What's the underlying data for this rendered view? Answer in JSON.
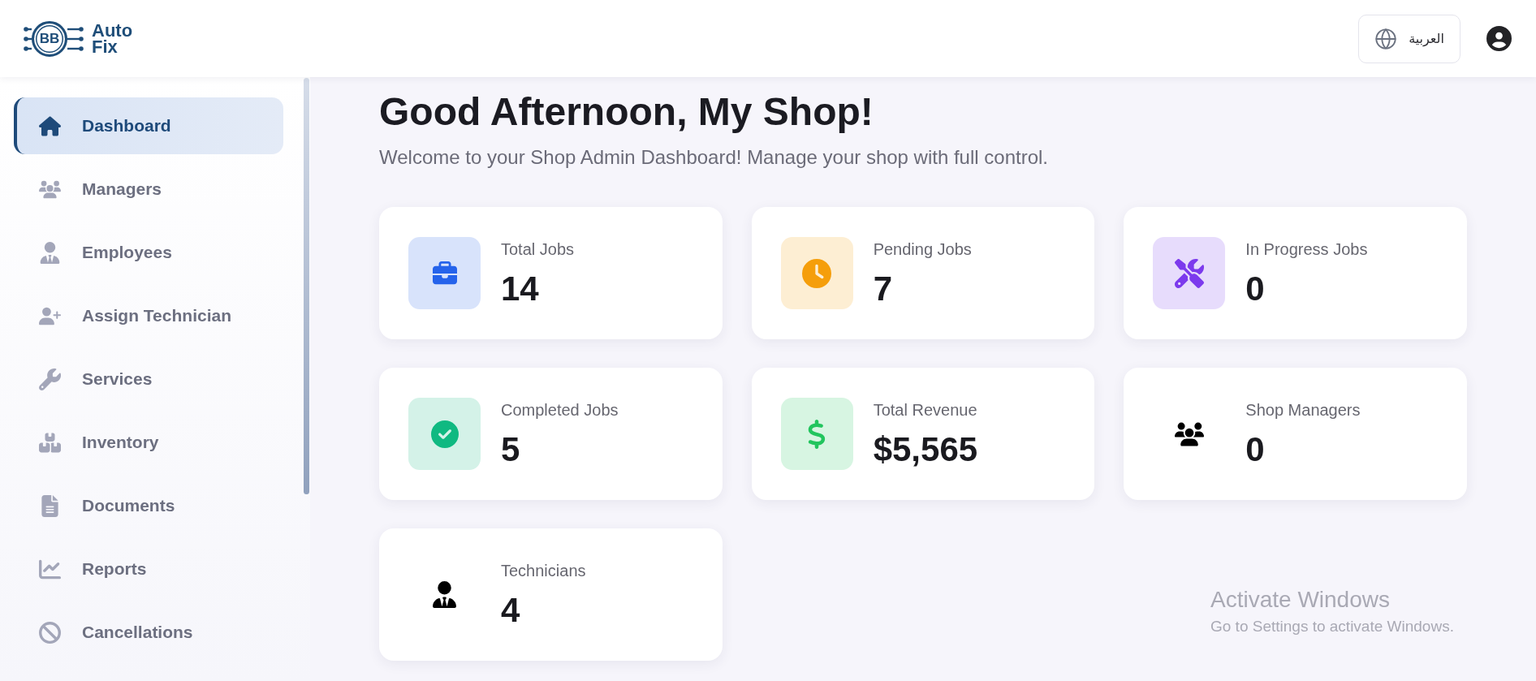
{
  "header": {
    "logo": {
      "initials": "BB",
      "name_lines": [
        "Auto",
        "Fix"
      ]
    },
    "language_button": {
      "label": "العربية"
    }
  },
  "sidebar": {
    "items": [
      {
        "label": "Dashboard",
        "selected": true
      },
      {
        "label": "Managers",
        "selected": false
      },
      {
        "label": "Employees",
        "selected": false
      },
      {
        "label": "Assign Technician",
        "selected": false
      },
      {
        "label": "Services",
        "selected": false
      },
      {
        "label": "Inventory",
        "selected": false
      },
      {
        "label": "Documents",
        "selected": false
      },
      {
        "label": "Reports",
        "selected": false
      },
      {
        "label": "Cancellations",
        "selected": false
      }
    ]
  },
  "main": {
    "greeting": "Good Afternoon, My Shop!",
    "subtitle": "Welcome to your Shop Admin Dashboard! Manage your shop with full control."
  },
  "stats": [
    {
      "label": "Total Jobs",
      "value": "14",
      "kind": "tinted",
      "color": "#2563eb"
    },
    {
      "label": "Pending Jobs",
      "value": "7",
      "kind": "tinted",
      "color": "#f59e0b"
    },
    {
      "label": "In Progress Jobs",
      "value": "0",
      "kind": "tinted",
      "color": "#7c3aed"
    },
    {
      "label": "Completed Jobs",
      "value": "5",
      "kind": "tinted",
      "color": "#10b981"
    },
    {
      "label": "Total Revenue",
      "value": "$5,565",
      "kind": "tinted",
      "color": "#22c55e"
    },
    {
      "label": "Shop Managers",
      "value": "0",
      "kind": "plain",
      "color": "#000000"
    },
    {
      "label": "Technicians",
      "value": "4",
      "kind": "plain",
      "color": "#000000"
    }
  ],
  "os_notice": {
    "title": "Activate Windows",
    "message": "Go to Settings to activate Windows."
  }
}
